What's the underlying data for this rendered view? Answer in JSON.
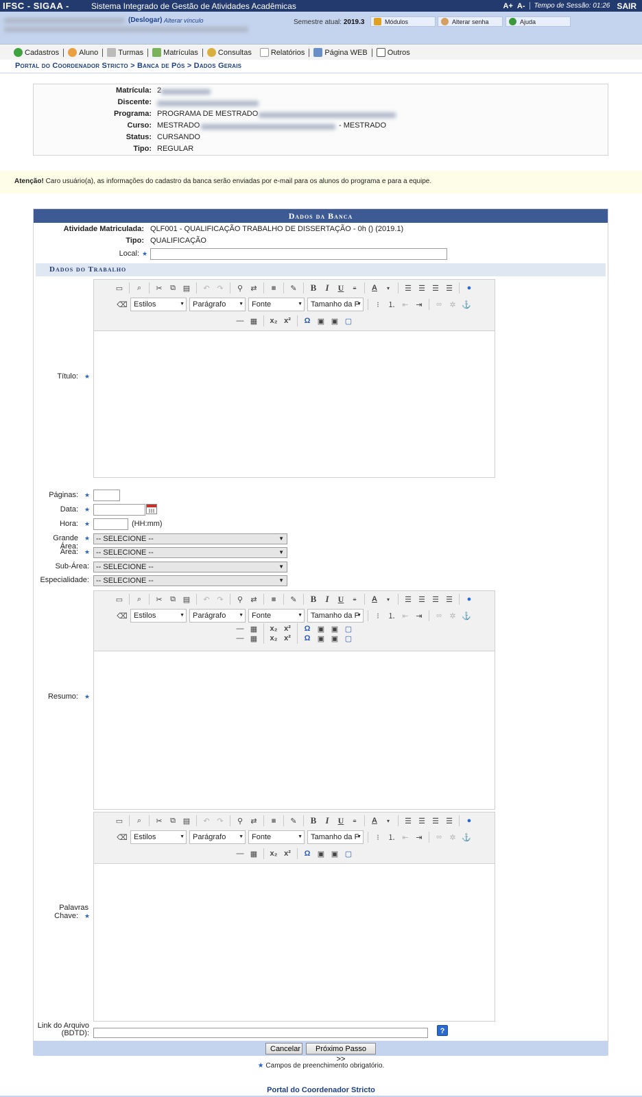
{
  "header": {
    "brand": "IFSC - SIGAA -",
    "system_name": "Sistema Integrado de Gestão de Atividades Acadêmicas",
    "font_increase": "A+",
    "font_decrease": "A-",
    "session_label": "Tempo de Sessão: 01:26",
    "logout": "SAIR"
  },
  "infobar": {
    "deslogar": "(Deslogar)",
    "alterar_vinculo": "Alterar vínculo",
    "semestre_label": "Semestre atual:",
    "semestre_value": "2019.3",
    "buttons": [
      {
        "label": "Módulos",
        "icon": "modules-icon"
      },
      {
        "label": "Alterar senha",
        "icon": "key-icon"
      },
      {
        "label": "Ajuda",
        "icon": "help-icon"
      }
    ]
  },
  "menu": [
    {
      "label": "Cadastros",
      "icon": "plus-icon"
    },
    {
      "label": "Aluno",
      "icon": "student-icon"
    },
    {
      "label": "Turmas",
      "icon": "class-icon"
    },
    {
      "label": "Matrículas",
      "icon": "enroll-icon"
    },
    {
      "label": "Consultas",
      "icon": "search-icon"
    },
    {
      "label": "Relatórios",
      "icon": "report-icon"
    },
    {
      "label": "Página WEB",
      "icon": "web-icon"
    },
    {
      "label": "Outros",
      "icon": "phone-icon"
    }
  ],
  "breadcrumb": "Portal do Coordenador Stricto > Banca de Pós > Dados Gerais",
  "student": {
    "matricula_label": "Matrícula:",
    "matricula_value": "2",
    "discente_label": "Discente:",
    "programa_label": "Programa:",
    "programa_value": "PROGRAMA DE MESTRADO",
    "curso_label": "Curso:",
    "curso_value": "MESTRADO",
    "curso_suffix": "- MESTRADO",
    "status_label": "Status:",
    "status_value": "CURSANDO",
    "tipo_label": "Tipo:",
    "tipo_value": "REGULAR"
  },
  "attention": {
    "title": "Atenção!",
    "text": "Caro usuário(a), as informações do cadastro da banca serão enviadas por e-mail para os alunos do programa e para a equipe."
  },
  "form": {
    "caption": "Dados da Banca",
    "atividade_label": "Atividade Matriculada:",
    "atividade_value": "QLF001 - QUALIFICAÇÃO TRABALHO DE DISSERTAÇÃO - 0h () (2019.1)",
    "tipo_label": "Tipo:",
    "tipo_value": "QUALIFICAÇÃO",
    "local_label": "Local:",
    "subcaption": "Dados do Trabalho",
    "titulo_label": "Título:",
    "paginas_label": "Páginas:",
    "data_label": "Data:",
    "hora_label": "Hora:",
    "hora_hint": "(HH:mm)",
    "grande_area_label": "Grande Área:",
    "area_label": "Área:",
    "sub_area_label": "Sub-Área:",
    "especialidade_label": "Especialidade:",
    "select_default": "-- SELECIONE --",
    "resumo_label": "Resumo:",
    "palavras_label_1": "Palavras",
    "palavras_label_2": "Chave:",
    "link_label_1": "Link do Arquivo",
    "link_label_2": "(BDTD):",
    "help": "?",
    "cancel": "Cancelar",
    "next": "Próximo Passo >>"
  },
  "editor": {
    "estilos": "Estilos",
    "paragrafo": "Parágrafo",
    "fonte": "Fonte",
    "tamanho": "Tamanho da F"
  },
  "required_star": "★",
  "required_note": "Campos de preenchimento obrigatório.",
  "footer": "Portal do Coordenador Stricto"
}
